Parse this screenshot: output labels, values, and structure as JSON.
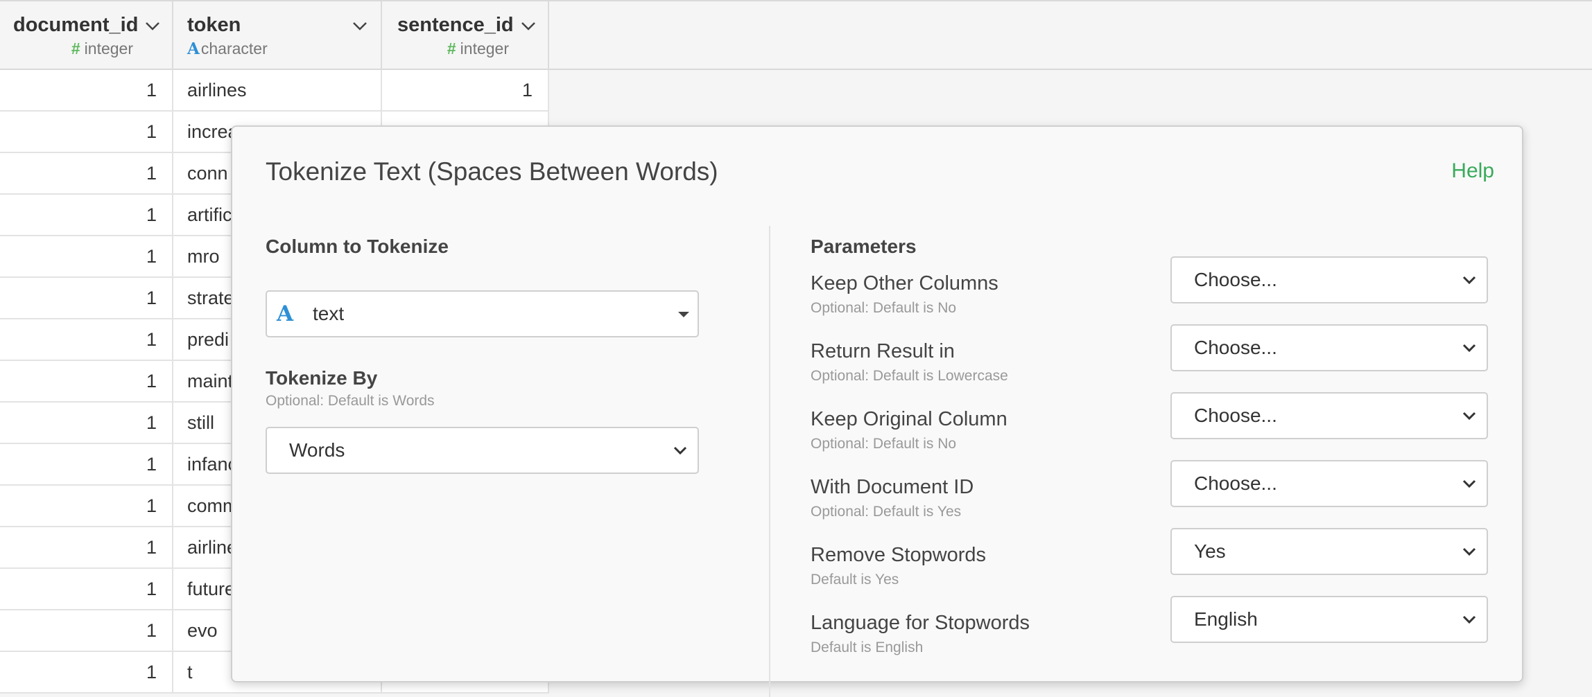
{
  "columns": [
    {
      "name": "document_id",
      "type": "integer",
      "type_icon": "#"
    },
    {
      "name": "token",
      "type": "character",
      "type_icon": "A"
    },
    {
      "name": "sentence_id",
      "type": "integer",
      "type_icon": "#"
    }
  ],
  "rows": [
    {
      "document_id": "1",
      "token": "airlines",
      "sentence_id": "1"
    },
    {
      "document_id": "1",
      "token": "increa",
      "sentence_id": ""
    },
    {
      "document_id": "1",
      "token": "conn",
      "sentence_id": ""
    },
    {
      "document_id": "1",
      "token": "artific",
      "sentence_id": ""
    },
    {
      "document_id": "1",
      "token": "mro",
      "sentence_id": ""
    },
    {
      "document_id": "1",
      "token": "strate",
      "sentence_id": ""
    },
    {
      "document_id": "1",
      "token": "predi",
      "sentence_id": ""
    },
    {
      "document_id": "1",
      "token": "maint",
      "sentence_id": ""
    },
    {
      "document_id": "1",
      "token": "still",
      "sentence_id": ""
    },
    {
      "document_id": "1",
      "token": "infanc",
      "sentence_id": ""
    },
    {
      "document_id": "1",
      "token": "comm",
      "sentence_id": ""
    },
    {
      "document_id": "1",
      "token": "airline",
      "sentence_id": ""
    },
    {
      "document_id": "1",
      "token": "future",
      "sentence_id": ""
    },
    {
      "document_id": "1",
      "token": "evo",
      "sentence_id": ""
    },
    {
      "document_id": "1",
      "token": "t",
      "sentence_id": ""
    }
  ],
  "dialog": {
    "title": "Tokenize Text (Spaces Between Words)",
    "help": "Help",
    "column_section": {
      "title": "Column to Tokenize",
      "selected": "text",
      "type_icon": "A"
    },
    "tokenize_by": {
      "title": "Tokenize By",
      "hint": "Optional: Default is Words",
      "value": "Words"
    },
    "parameters": {
      "title": "Parameters",
      "items": [
        {
          "label": "Keep Other Columns",
          "hint": "Optional: Default is No",
          "value": "Choose..."
        },
        {
          "label": "Return Result in",
          "hint": "Optional: Default is Lowercase",
          "value": "Choose..."
        },
        {
          "label": "Keep Original Column",
          "hint": "Optional: Default is No",
          "value": "Choose..."
        },
        {
          "label": "With Document ID",
          "hint": "Optional: Default is Yes",
          "value": "Choose..."
        },
        {
          "label": "Remove Stopwords",
          "hint": "Default is Yes",
          "value": "Yes"
        },
        {
          "label": "Language for Stopwords",
          "hint": "Default is English",
          "value": "English"
        }
      ]
    }
  },
  "colors": {
    "accent_green": "#3aaa5c",
    "integer_icon": "#5cb85c",
    "character_icon": "#2e8fd6"
  }
}
